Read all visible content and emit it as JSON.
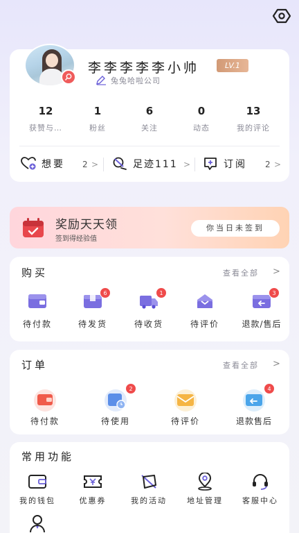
{
  "settings_icon": "settings-hexagon-icon",
  "profile": {
    "username": "李李李李李小帅",
    "level": "LV.1",
    "company": "兔兔哈啦公司",
    "stats": [
      {
        "value": "12",
        "label": "获赞与…"
      },
      {
        "value": "1",
        "label": "粉丝"
      },
      {
        "value": "6",
        "label": "关注"
      },
      {
        "value": "0",
        "label": "动态"
      },
      {
        "value": "13",
        "label": "我的评论"
      }
    ],
    "quick_links": [
      {
        "label": "想要",
        "count": "2",
        "icon": "heart-plus-icon"
      },
      {
        "label": "足迹111",
        "count": "",
        "icon": "footprint-icon"
      },
      {
        "label": "订阅",
        "count": "2",
        "icon": "subscribe-plus-icon"
      }
    ]
  },
  "reward": {
    "title": "奖励天天领",
    "subtitle": "签到得经验值",
    "button": "你当日未签到"
  },
  "purchase": {
    "title": "购买",
    "see_all": "查看全部",
    "items": [
      {
        "label": "待付款",
        "badge": "",
        "icon": "wallet-icon"
      },
      {
        "label": "待发货",
        "badge": "6",
        "icon": "package-icon"
      },
      {
        "label": "待收货",
        "badge": "1",
        "icon": "truck-icon"
      },
      {
        "label": "待评价",
        "badge": "",
        "icon": "review-inbox-icon"
      },
      {
        "label": "退款/售后",
        "badge": "3",
        "icon": "refund-icon"
      }
    ]
  },
  "orders": {
    "title": "订单",
    "see_all": "查看全部",
    "items": [
      {
        "label": "待付款",
        "badge": "",
        "icon": "wallet-icon"
      },
      {
        "label": "待使用",
        "badge": "2",
        "icon": "ticket-clock-icon"
      },
      {
        "label": "待评价",
        "badge": "",
        "icon": "envelope-icon"
      },
      {
        "label": "退款售后",
        "badge": "4",
        "icon": "refund-icon"
      }
    ]
  },
  "functions": {
    "title": "常用功能",
    "items": [
      {
        "label": "我的钱包",
        "icon": "wallet-icon"
      },
      {
        "label": "优惠券",
        "icon": "coupon-icon"
      },
      {
        "label": "我的活动",
        "icon": "activity-icon"
      },
      {
        "label": "地址管理",
        "icon": "location-icon"
      },
      {
        "label": "客服中心",
        "icon": "headset-icon"
      }
    ],
    "extra_icon": "user-icon"
  },
  "colors": {
    "accent": "#5b4fd6",
    "badge": "#ef4b4b",
    "level_bg": "#d29a76",
    "reward_bg": "#ffd6dc"
  }
}
